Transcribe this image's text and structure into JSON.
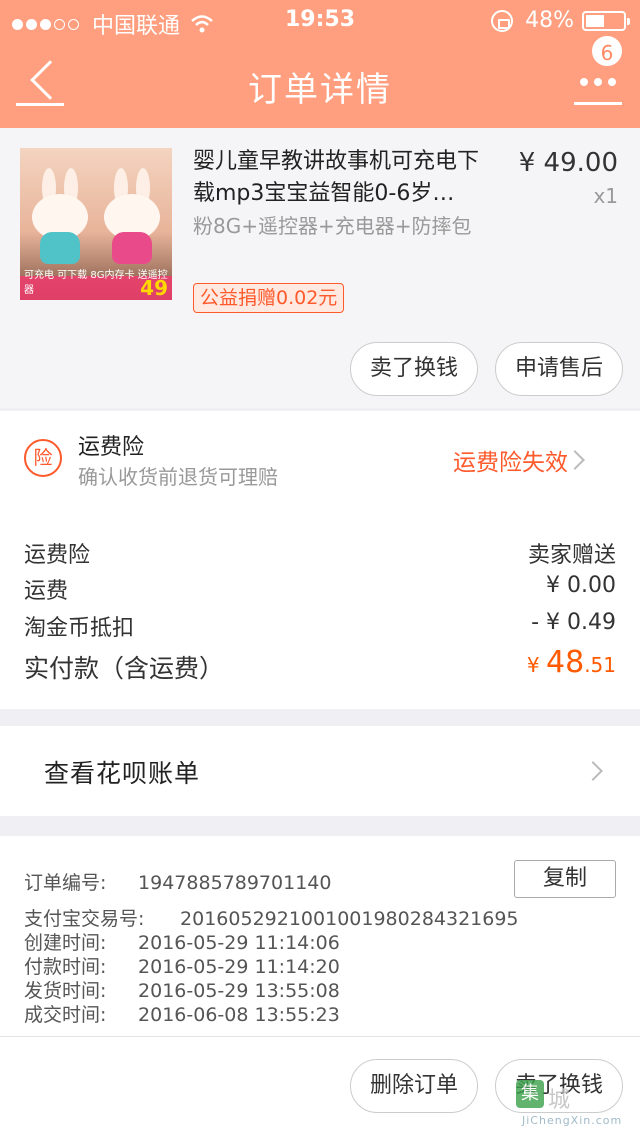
{
  "status_bar": {
    "carrier": "中国联通",
    "time": "19:53",
    "battery": "48%",
    "signal_bars": 3,
    "signal_total": 5,
    "battery_level": 0.48
  },
  "nav": {
    "title": "订单详情",
    "back_icon": "back-arrow-icon",
    "more_icon": "more-icon",
    "badge": "6"
  },
  "product": {
    "title": "婴儿童早教讲故事机可充电下载mp3宝宝益智能0-6岁…",
    "sku": "粉8G+遥控器+充电器+防摔包",
    "charity_tag": "公益捐赠0.02元",
    "price": "¥ 49.00",
    "qty": "x1",
    "thumb_text": "可充电 可下载 8G内存卡 送遥控器",
    "thumb_price": "49",
    "sell_button": "卖了换钱",
    "after_sale_button": "申请售后"
  },
  "insurance": {
    "icon_char": "险",
    "title": "运费险",
    "subtitle": "确认收货前退货可理赔",
    "status": "运费险失效"
  },
  "fees": [
    {
      "label": "运费险",
      "value": "卖家赠送"
    },
    {
      "label": "运费",
      "value": "¥ 0.00"
    },
    {
      "label": "淘金币抵扣",
      "value": "- ¥ 0.49"
    }
  ],
  "total": {
    "label": "实付款（含运费）",
    "currency": "¥ ",
    "integer": "48",
    "decimal": ".51"
  },
  "huabei": {
    "label": "查看花呗账单"
  },
  "order_info": {
    "order_no_label": "订单编号:",
    "order_no": "1947885789701140",
    "copy_button": "复制",
    "alipay_label": "支付宝交易号:",
    "alipay_no": "2016052921001001980284321695",
    "created_label": "创建时间:",
    "created": "2016-05-29 11:14:06",
    "paid_label": "付款时间:",
    "paid": "2016-05-29 11:14:20",
    "shipped_label": "发货时间:",
    "shipped": "2016-05-29 13:55:08",
    "completed_label": "成交时间:",
    "completed": "2016-06-08 13:55:23"
  },
  "footer": {
    "delete_button": "删除订单",
    "sell_button": "卖了换钱"
  },
  "watermark": {
    "box_char": "集",
    "name": "城",
    "url": "JiChengXin.com"
  },
  "colors": {
    "header": "#ff9f7f",
    "accent": "#ff5a2c",
    "total": "#ff5a00"
  }
}
